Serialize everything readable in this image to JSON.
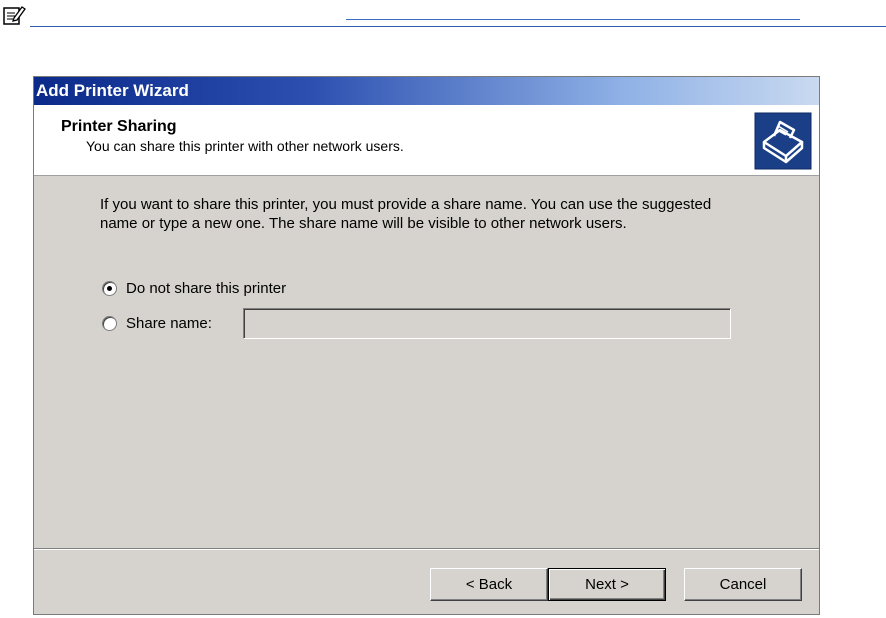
{
  "note": {
    "icon": "note-pencil-icon"
  },
  "wizard": {
    "title": "Add Printer Wizard",
    "header": {
      "title": "Printer Sharing",
      "subtitle": "You can share this printer with other network users.",
      "icon": "printer-icon"
    },
    "intro_line1": "If you want to share this printer, you must provide a share name. You can use the suggested",
    "intro_line2": "name or type a new one. The share name will be visible to other network users.",
    "options": {
      "do_not_share": {
        "label": "Do not share this printer",
        "selected": true
      },
      "share_name": {
        "label": "Share name:",
        "selected": false,
        "value": ""
      }
    },
    "buttons": {
      "back": "< Back",
      "next": "Next >",
      "cancel": "Cancel"
    }
  }
}
